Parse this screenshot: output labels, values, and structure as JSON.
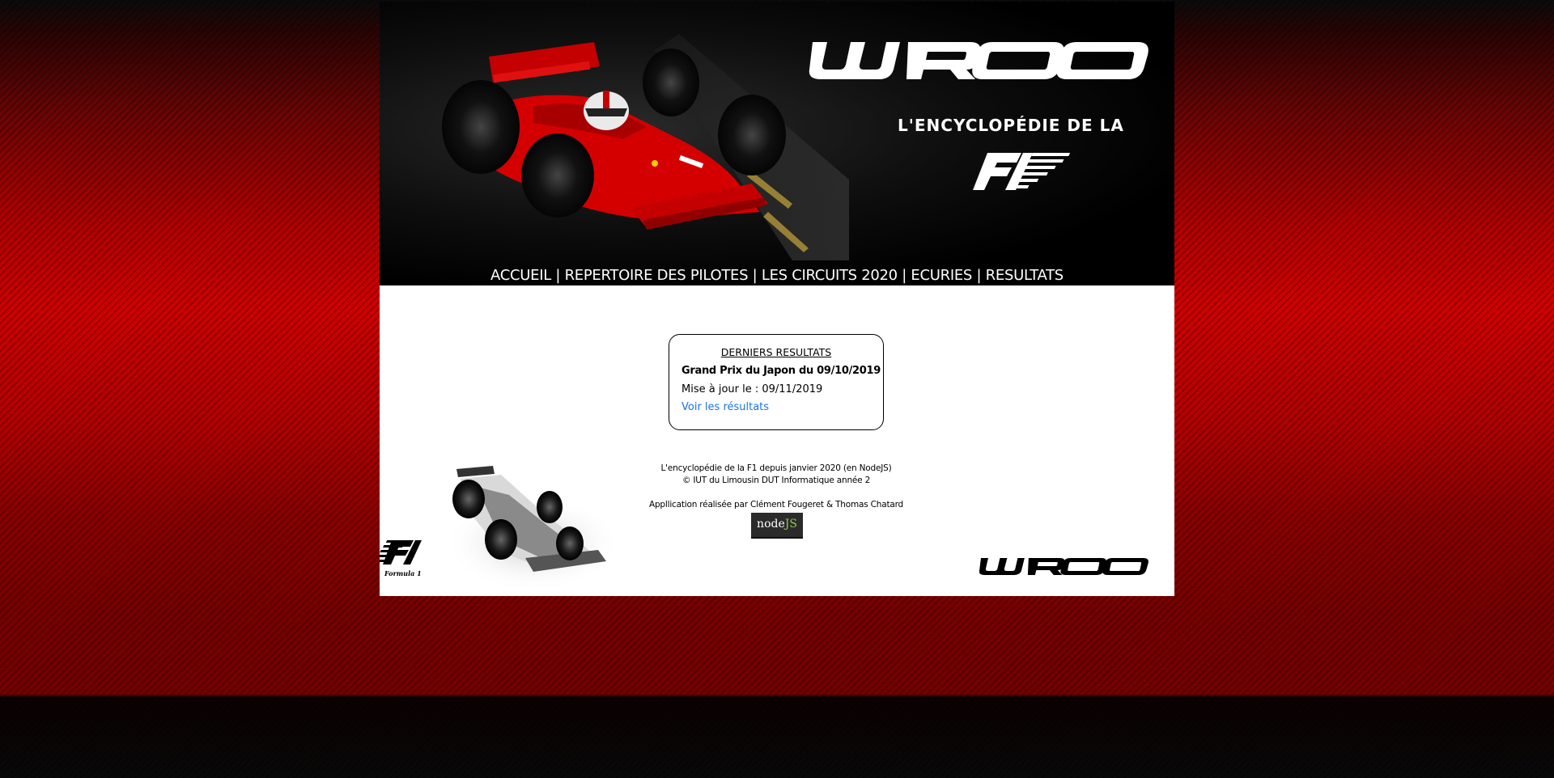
{
  "header": {
    "brand": "WROOM",
    "tagline": "L'ENCYCLOPÉDIE DE LA",
    "f1_logo": "F1"
  },
  "nav": {
    "items": [
      {
        "label": "ACCUEIL"
      },
      {
        "label": "REPERTOIRE DES PILOTES"
      },
      {
        "label": "LES CIRCUITS 2020"
      },
      {
        "label": "ECURIES"
      },
      {
        "label": "RESULTATS"
      }
    ],
    "separator": "|"
  },
  "latest_results": {
    "title": "DERNIERS RESULTATS",
    "grand_prix": "Grand Prix du Japon du 09/10/2019",
    "updated": "Mise à jour le : 09/11/2019",
    "link": "Voir les résultats"
  },
  "footer": {
    "line1": "L'encyclopédie de la F1 depuis janvier 2020 (en NodeJS)",
    "line2": "© IUT du Limousin DUT Informatique année 2",
    "line3": "Appllication réalisée par Clément Fougeret & Thomas Chatard",
    "nodejs_badge": {
      "node": "node",
      "js": "JS"
    },
    "f1_logo_caption": "Formula 1",
    "brand": "WROOM"
  },
  "colors": {
    "background_red": "#d10000",
    "background_dark": "#141414",
    "link_blue": "#1a73e8",
    "nodejs_green": "#8cc84b"
  }
}
